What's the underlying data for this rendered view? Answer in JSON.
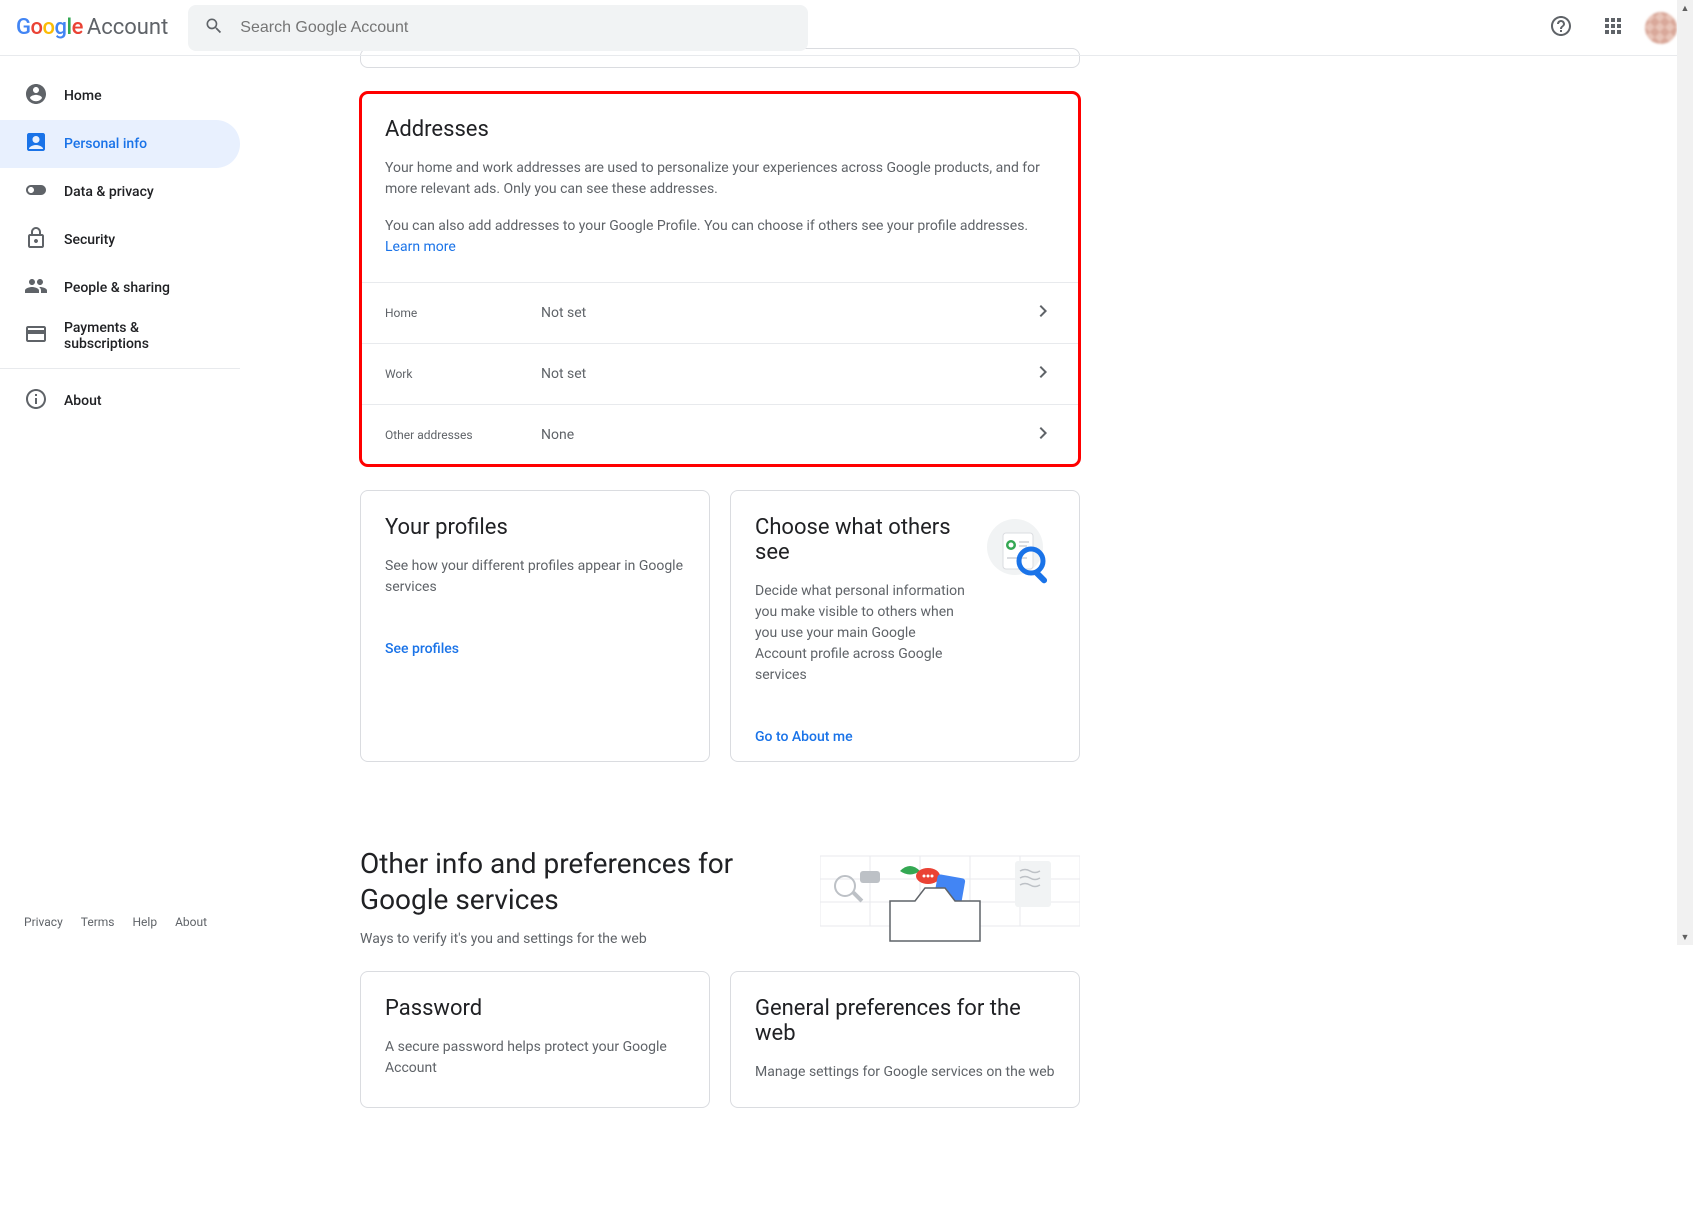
{
  "header": {
    "logo_account": "Account",
    "search_placeholder": "Search Google Account"
  },
  "sidebar": {
    "items": [
      {
        "label": "Home"
      },
      {
        "label": "Personal info"
      },
      {
        "label": "Data & privacy"
      },
      {
        "label": "Security"
      },
      {
        "label": "People & sharing"
      },
      {
        "label": "Payments & subscriptions"
      },
      {
        "label": "About"
      }
    ]
  },
  "footer": {
    "privacy": "Privacy",
    "terms": "Terms",
    "help": "Help",
    "about": "About"
  },
  "addresses": {
    "title": "Addresses",
    "desc1": "Your home and work addresses are used to personalize your experiences across Google products, and for more relevant ads. Only you can see these addresses.",
    "desc2a": "You can also add addresses to your Google Profile. You can choose if others see your profile addresses. ",
    "learn_more": "Learn more",
    "rows": [
      {
        "label": "Home",
        "value": "Not set"
      },
      {
        "label": "Work",
        "value": "Not set"
      },
      {
        "label": "Other addresses",
        "value": "None"
      }
    ]
  },
  "profiles": {
    "title": "Your profiles",
    "desc": "See how your different profiles appear in Google services",
    "link": "See profiles"
  },
  "others_see": {
    "title": "Choose what others see",
    "desc": "Decide what personal information you make visible to others when you use your main Google Account profile across Google services",
    "link": "Go to About me"
  },
  "other_prefs": {
    "title": "Other info and preferences for Google services",
    "sub": "Ways to verify it's you and settings for the web"
  },
  "password": {
    "title": "Password",
    "desc": "A secure password helps protect your Google Account"
  },
  "general_prefs": {
    "title": "General preferences for the web",
    "desc": "Manage settings for Google services on the web"
  }
}
